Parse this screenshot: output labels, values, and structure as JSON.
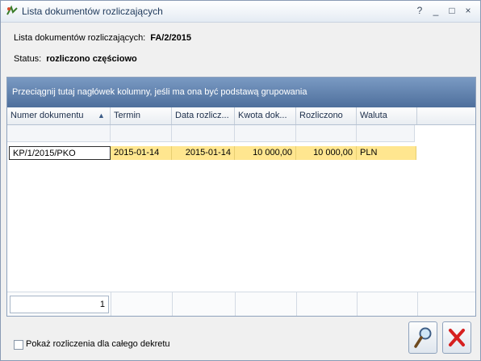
{
  "window": {
    "title": "Lista dokumentów rozliczających",
    "buttons": [
      "?",
      "_",
      "□",
      "×"
    ]
  },
  "info": {
    "doc_label": "Lista dokumentów rozliczających:",
    "doc_value": "FA/2/2015",
    "status_label": "Status:",
    "status_value": "rozliczono częściowo"
  },
  "grid": {
    "group_hint": "Przeciągnij tutaj nagłówek kolumny, jeśli ma ona być podstawą grupowania",
    "columns": [
      "Numer dokumentu",
      "Termin",
      "Data rozlicz...",
      "Kwota dok...",
      "Rozliczono",
      "Waluta"
    ],
    "sort_indicator": "▲",
    "rows": [
      [
        "KP/1/2015/PKO",
        "2015-01-14",
        "2015-01-14",
        "10 000,00",
        "10 000,00",
        "PLN"
      ]
    ],
    "footer_count": "1"
  },
  "checkbox": {
    "label": "Pokaż rozliczenia dla całego dekretu",
    "checked": false
  },
  "buttons": {
    "search": "search-icon",
    "close": "close-icon"
  },
  "colors": {
    "highlight_row": "#ffe68f",
    "group_bar": "#4e6f9c",
    "close_red": "#d62020"
  }
}
